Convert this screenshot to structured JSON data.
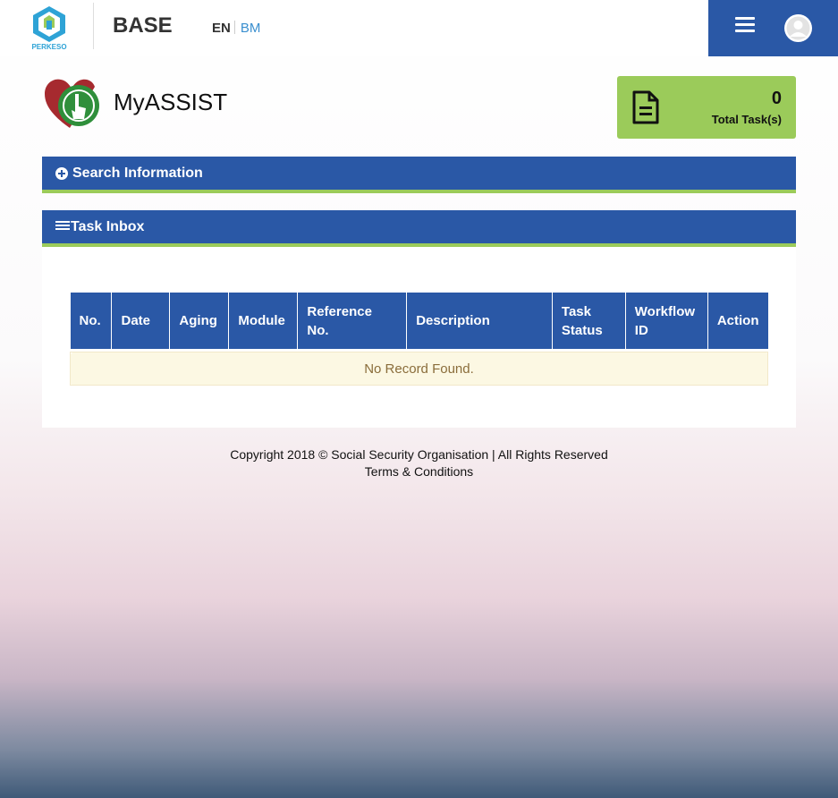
{
  "header": {
    "logo_text": "PERKESO",
    "brand": "BASE",
    "lang_en": "EN",
    "lang_bm": "BM"
  },
  "app": {
    "title": "MyASSIST"
  },
  "task_card": {
    "count": "0",
    "label": "Total Task(s)"
  },
  "search_panel": {
    "title": "Search Information"
  },
  "inbox_panel": {
    "title": "Task Inbox",
    "columns": [
      "No.",
      "Date",
      "Aging",
      "Module",
      "Reference No.",
      "Description",
      "Task Status",
      "Workflow ID",
      "Action"
    ],
    "empty_text": "No Record Found."
  },
  "footer": {
    "copyright": "Copyright 2018 © Social Security Organisation | All Rights Reserved",
    "terms": "Terms & Conditions"
  },
  "colors": {
    "primary": "#2a58a6",
    "accent": "#9bcb5a",
    "empty_bg": "#fcf8e3"
  }
}
